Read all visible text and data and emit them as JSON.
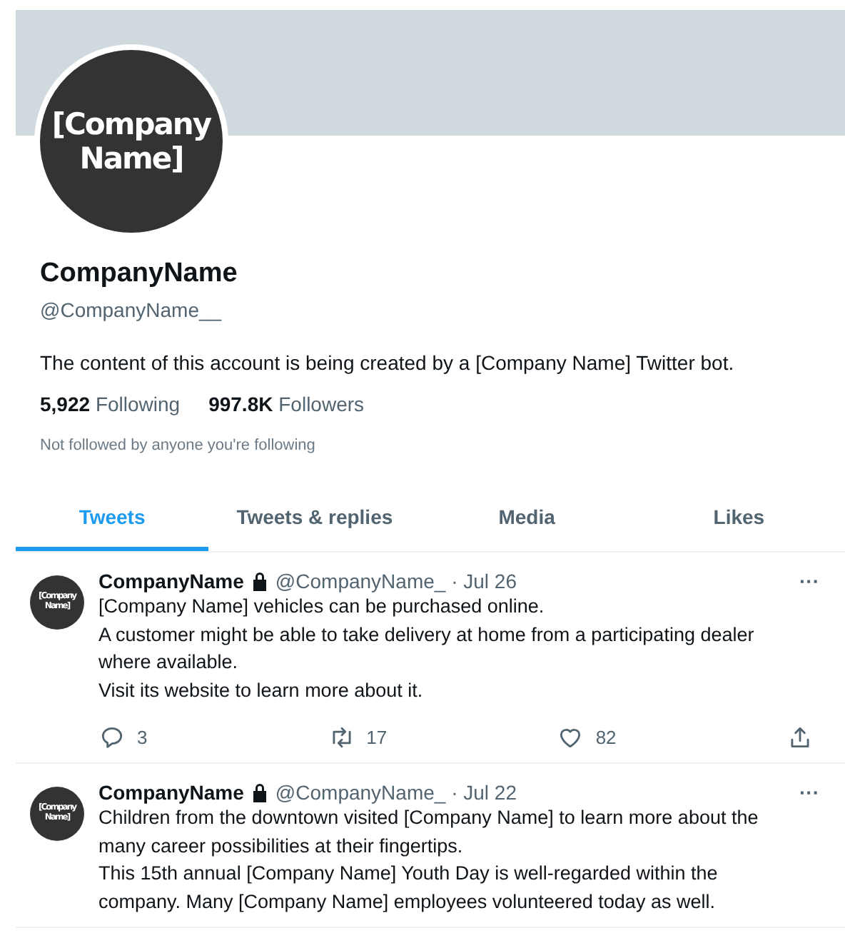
{
  "profile": {
    "avatar_text": "[Company Name]",
    "name": "CompanyName",
    "handle": "@CompanyName__",
    "bio": "The content of this account is being created by a [Company Name] Twitter bot.",
    "stats": [
      {
        "count": "5,922",
        "label": "Following"
      },
      {
        "count": "997.8K",
        "label": "Followers"
      }
    ],
    "followed_note": "Not followed by anyone you're following"
  },
  "tabs": [
    {
      "label": "Tweets",
      "selected": true
    },
    {
      "label": "Tweets & replies",
      "selected": false
    },
    {
      "label": "Media",
      "selected": false
    },
    {
      "label": "Likes",
      "selected": false
    }
  ],
  "tweets": [
    {
      "avatar_text": "[Company Name]",
      "name": "CompanyName",
      "locked": true,
      "handle": "@CompanyName_",
      "separator": "·",
      "date": "Jul 26",
      "more": "···",
      "paragraphs": [
        "[Company Name] vehicles can be purchased online.",
        "A customer might be able to take delivery at home from a participating dealer where available.",
        "Visit its website to learn more about it."
      ],
      "replies": "3",
      "retweets": "17",
      "likes": "82"
    },
    {
      "avatar_text": "[Company Name]",
      "name": "CompanyName",
      "locked": true,
      "handle": "@CompanyName_",
      "separator": "·",
      "date": "Jul 22",
      "more": "···",
      "paragraphs": [
        "Children from the downtown visited [Company Name] to learn more about the many career possibilities at their fingertips.",
        "This 15th annual [Company Name] Youth Day is well-regarded within the company. Many [Company Name] employees volunteered today as well."
      ]
    }
  ]
}
